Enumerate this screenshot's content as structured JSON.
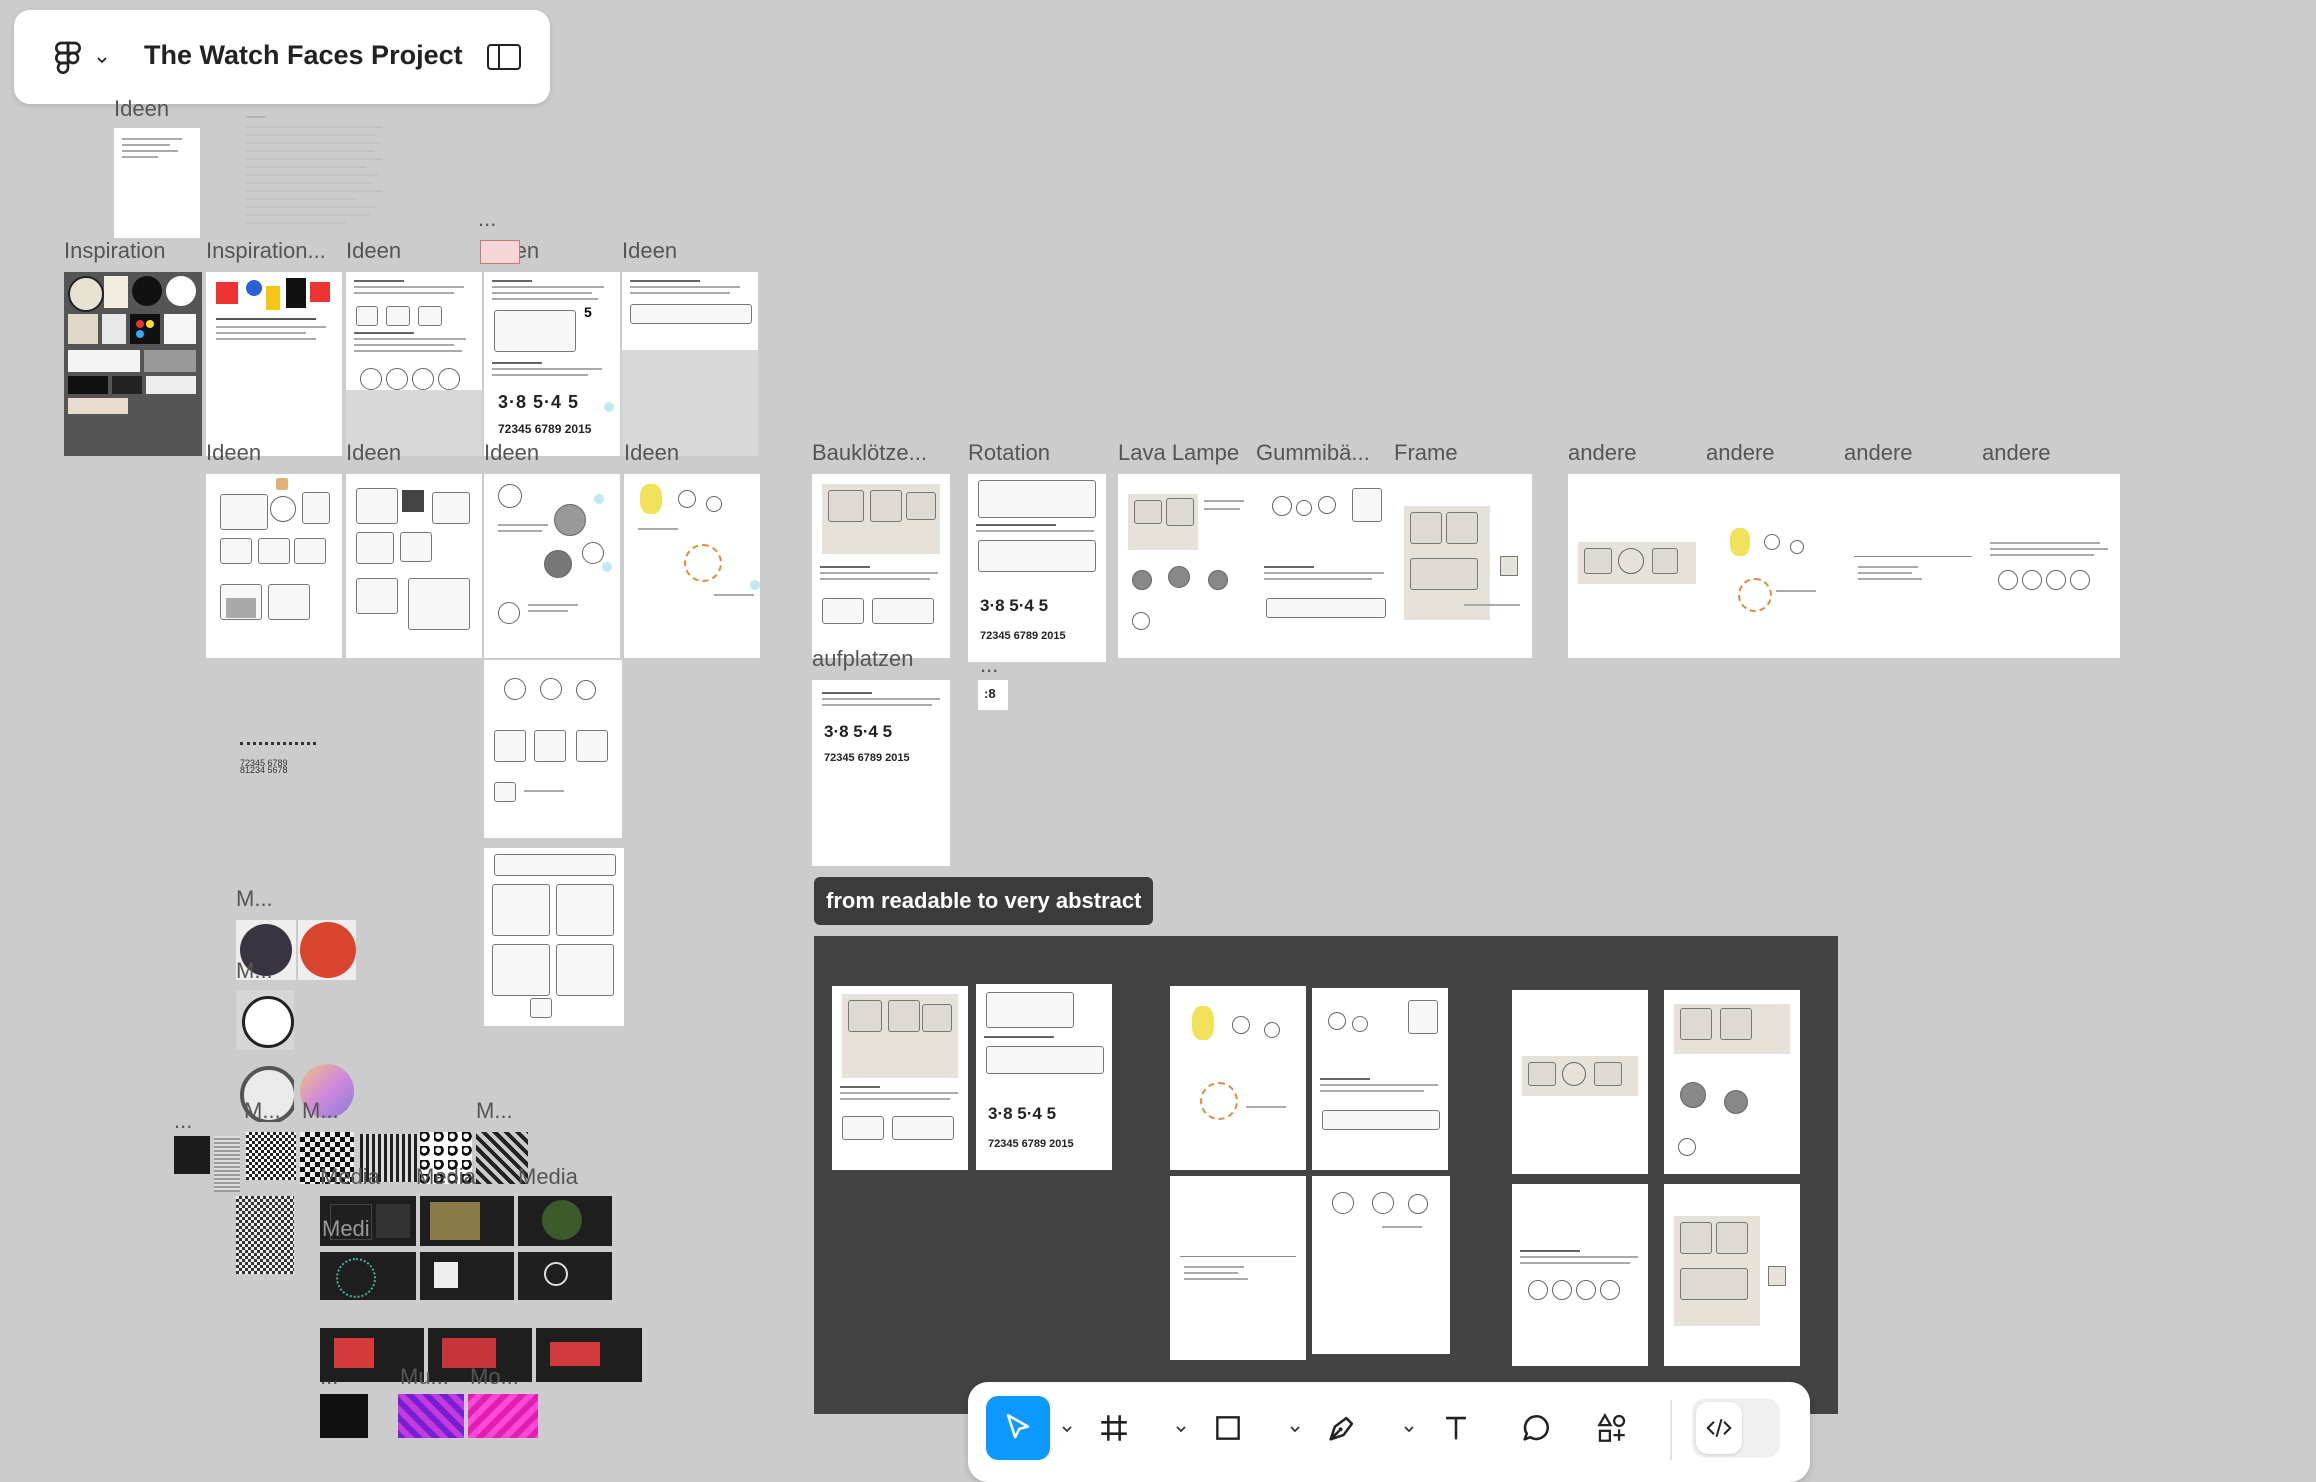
{
  "header": {
    "project_title": "The Watch Faces Project"
  },
  "labels": {
    "ideen_top": "Ideen",
    "inspiration": "Inspiration",
    "inspiration_2": "Inspiration...",
    "ideen_r1_a": "Ideen",
    "ellipsis_r1": "...",
    "ideen_r1_b": "Ideen",
    "ideen_r1_c": "Ideen",
    "ideen_r2_a": "Ideen",
    "ideen_r2_b": "Ideen",
    "ideen_r2_c": "Ideen",
    "ideen_r2_d": "Ideen",
    "baukloetze": "Bauklötze...",
    "rotation": "Rotation",
    "lava_lampe": "Lava Lampe",
    "gummibae": "Gummibä...",
    "frame": "Frame",
    "andere_1": "andere",
    "andere_2": "andere",
    "andere_3": "andere",
    "andere_4": "andere",
    "aufplatzen": "aufplatzen",
    "ellipsis_rot": "...",
    "m_1": "M...",
    "m_2": "M...",
    "m_3": "M...",
    "m_4": "M...",
    "m_5": "M...",
    "ellipsis_media": "...",
    "media_1": "Media",
    "media_2": "Media",
    "media_3": "Media",
    "media_4": "Medi",
    "ellipsis_bottom": "...",
    "mu_1": "Mu...",
    "mo_1": "Mo..."
  },
  "section": {
    "title": "from readable to very abstract"
  },
  "toolbar": {
    "tools": [
      {
        "name": "move-tool",
        "active": true
      },
      {
        "name": "frame-tool",
        "active": false
      },
      {
        "name": "shape-tool",
        "active": false
      },
      {
        "name": "pen-tool",
        "active": false
      },
      {
        "name": "text-tool",
        "active": false
      },
      {
        "name": "comment-tool",
        "active": false
      },
      {
        "name": "resources-tool",
        "active": false
      },
      {
        "name": "dev-mode-toggle",
        "active": false
      }
    ]
  },
  "colors": {
    "canvas": "#cccccc",
    "accent": "#0d99ff",
    "section_bg": "#434343",
    "frame_bg": "#ffffff"
  }
}
